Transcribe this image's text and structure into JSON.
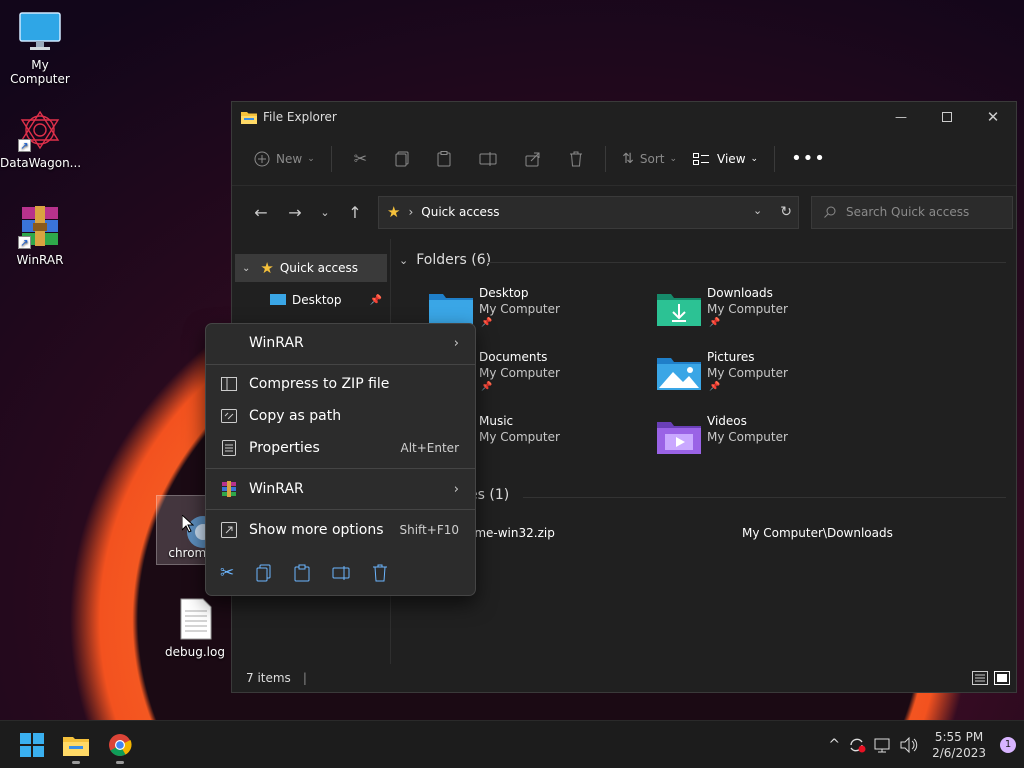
{
  "desktop": {
    "icons": [
      {
        "label": "My Computer"
      },
      {
        "label": "DataWagon..."
      },
      {
        "label": "WinRAR"
      },
      {
        "label": "chrome"
      },
      {
        "label": "debug.log"
      }
    ]
  },
  "explorer": {
    "title": "File Explorer",
    "toolbar": {
      "new_label": "New",
      "sort_label": "Sort",
      "view_label": "View"
    },
    "address": {
      "path": "Quick access"
    },
    "search": {
      "placeholder": "Search Quick access"
    },
    "navpane": {
      "items": [
        {
          "label": "Quick access"
        },
        {
          "label": "Desktop"
        }
      ]
    },
    "content": {
      "folders_heading": "Folders (6)",
      "folders": [
        {
          "name": "Desktop",
          "location": "My Computer",
          "pinned": true
        },
        {
          "name": "Downloads",
          "location": "My Computer",
          "pinned": true
        },
        {
          "name": "Documents",
          "location": "My Computer",
          "pinned": true
        },
        {
          "name": "Pictures",
          "location": "My Computer",
          "pinned": true
        },
        {
          "name": "Music",
          "location": "My Computer",
          "pinned": false
        },
        {
          "name": "Videos",
          "location": "My Computer",
          "pinned": false
        }
      ],
      "recent_heading": "es (1)",
      "recent_files": [
        {
          "name": "ome-win32.zip",
          "location": "My Computer\\Downloads"
        }
      ]
    },
    "status": {
      "items_count": "7 items"
    }
  },
  "context_menu": {
    "items": [
      {
        "label": "WinRAR",
        "shortcut": ""
      },
      {
        "label": "Compress to ZIP file",
        "shortcut": ""
      },
      {
        "label": "Copy as path",
        "shortcut": ""
      },
      {
        "label": "Properties",
        "shortcut": "Alt+Enter"
      },
      {
        "label": "WinRAR",
        "shortcut": ""
      },
      {
        "label": "Show more options",
        "shortcut": "Shift+F10"
      }
    ]
  },
  "taskbar": {
    "time": "5:55 PM",
    "date": "2/6/2023",
    "notification_count": "1"
  },
  "colors": {
    "accent": "#6cb6ff",
    "folder_yellow": "#f5c13b",
    "explorer_bg": "#202020",
    "menu_bg": "#2c2c2c"
  }
}
